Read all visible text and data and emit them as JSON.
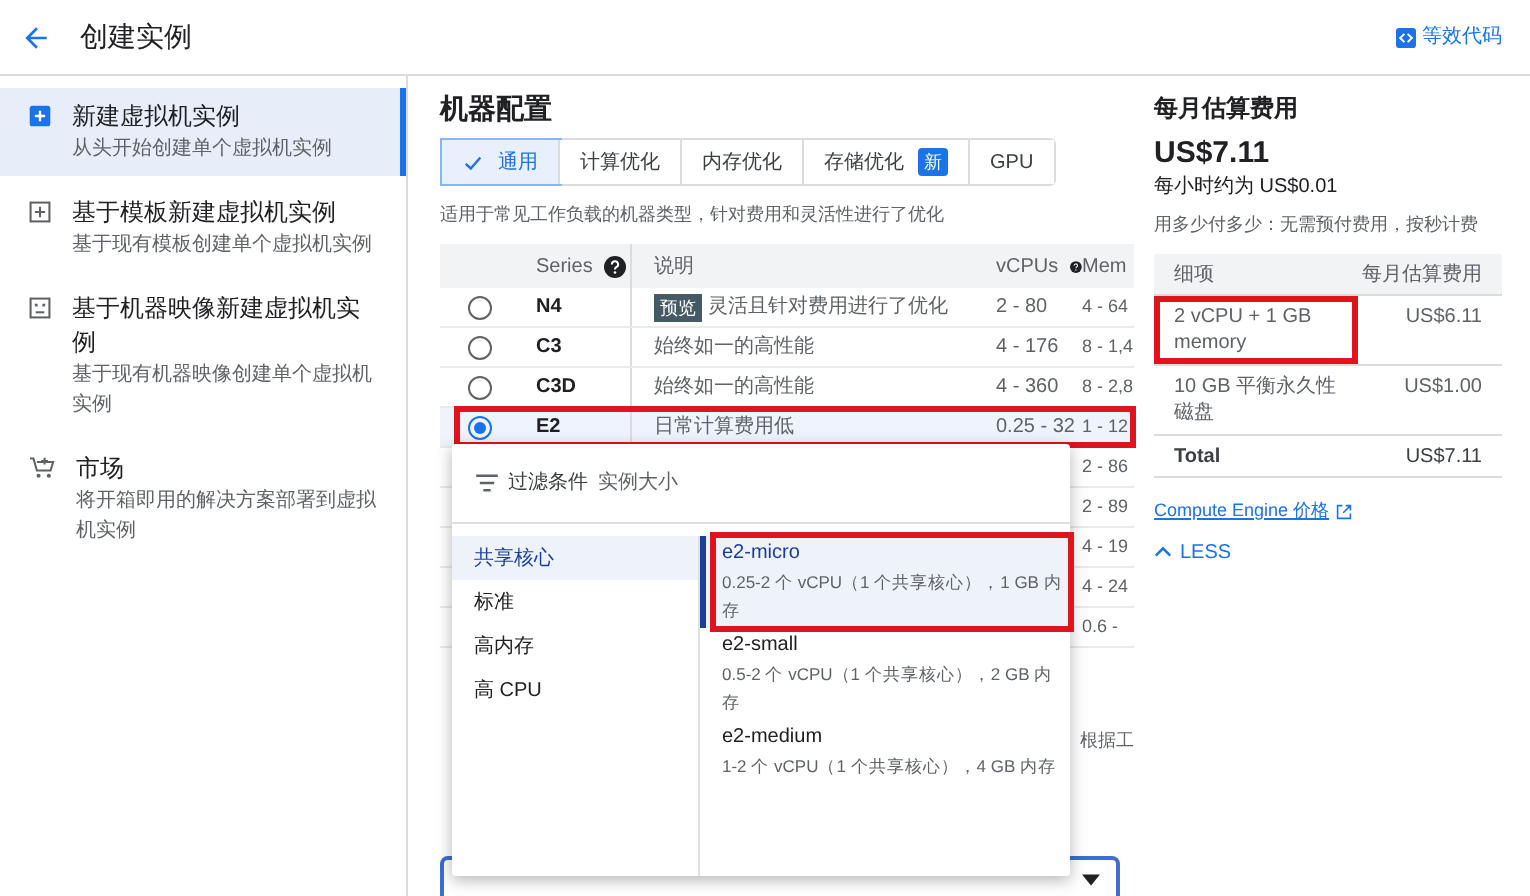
{
  "header": {
    "title": "创建实例",
    "code_link": "等效代码"
  },
  "sidebar": {
    "items": [
      {
        "kind": "plus",
        "title": "新建虚拟机实例",
        "subtitle": "从头开始创建单个虚拟机实例",
        "selected": true
      },
      {
        "kind": "template",
        "title": "基于模板新建虚拟机实例",
        "subtitle": "基于现有模板创建单个虚拟机实例",
        "selected": false
      },
      {
        "kind": "image",
        "title": "基于机器映像新建虚拟机实例",
        "subtitle": "基于现有机器映像创建单个虚拟机实例",
        "selected": false
      },
      {
        "kind": "cart",
        "title": "市场",
        "subtitle": "将开箱即用的解决方案部署到虚拟机实例",
        "selected": false
      }
    ]
  },
  "machine_config": {
    "title": "机器配置",
    "tabs": [
      {
        "label": "通用",
        "selected": true
      },
      {
        "label": "计算优化",
        "selected": false
      },
      {
        "label": "内存优化",
        "selected": false
      },
      {
        "label": "存储优化",
        "badge": "新",
        "selected": false
      },
      {
        "label": "GPU",
        "selected": false
      }
    ],
    "description": "适用于常见工作负载的机器类型，针对费用和灵活性进行了优化",
    "table": {
      "columns": [
        {
          "label": "Series",
          "help": true
        },
        {
          "label": "说明",
          "help": false
        },
        {
          "label": "vCPUs",
          "help": true
        },
        {
          "label": "Mem",
          "help": false
        }
      ],
      "rows": [
        {
          "series": "N4",
          "badge": "预览",
          "description": "灵活且针对费用进行了优化",
          "vcpus": "2 - 80",
          "memory": "4 - 64",
          "selected": false,
          "highlighted": false
        },
        {
          "series": "C3",
          "description": "始终如一的高性能",
          "vcpus": "4 - 176",
          "memory": "8 - 1,4",
          "selected": false,
          "highlighted": false
        },
        {
          "series": "C3D",
          "description": "始终如一的高性能",
          "vcpus": "4 - 360",
          "memory": "8 - 2,8",
          "selected": false,
          "highlighted": false
        },
        {
          "series": "E2",
          "description": "日常计算费用低",
          "vcpus": "0.25 - 32",
          "memory": "1 - 12",
          "selected": true,
          "highlighted": true
        },
        {
          "memory": "2 - 86"
        },
        {
          "memory": "2 - 89"
        },
        {
          "memory": "4 - 19"
        },
        {
          "memory": "4 - 24"
        },
        {
          "memory": "0.6 -"
        }
      ]
    },
    "note_fragment": "根据工"
  },
  "dropdown": {
    "filter_label": "过滤条件",
    "filter_value": "实例大小",
    "categories": [
      {
        "label": "共享核心",
        "selected": true
      },
      {
        "label": "标准",
        "selected": false
      },
      {
        "label": "高内存",
        "selected": false
      },
      {
        "label": "高 CPU",
        "selected": false
      }
    ],
    "machine_types": [
      {
        "name": "e2-micro",
        "detail": "0.25-2 个 vCPU（1 个共享核心），1 GB 内存",
        "selected": true,
        "highlighted": true
      },
      {
        "name": "e2-small",
        "detail": "0.5-2 个 vCPU（1 个共享核心），2 GB 内存",
        "selected": false,
        "highlighted": false
      },
      {
        "name": "e2-medium",
        "detail": "1-2 个 vCPU（1 个共享核心），4 GB 内存",
        "selected": false,
        "highlighted": false
      }
    ]
  },
  "cost": {
    "title": "每月估算费用",
    "monthly": "US$7.11",
    "hourly": "每小时约为 US$0.01",
    "note": "用多少付多少：无需预付费用，按秒计费",
    "columns": [
      "细项",
      "每月估算费用"
    ],
    "rows": [
      {
        "item": "2 vCPU + 1 GB memory",
        "cost": "US$6.11",
        "highlighted": true
      },
      {
        "item": "10 GB 平衡永久性磁盘",
        "cost": "US$1.00",
        "highlighted": false
      }
    ],
    "total": {
      "label": "Total",
      "cost": "US$7.11"
    },
    "pricing_link": "Compute Engine 价格",
    "less_button": "LESS"
  }
}
